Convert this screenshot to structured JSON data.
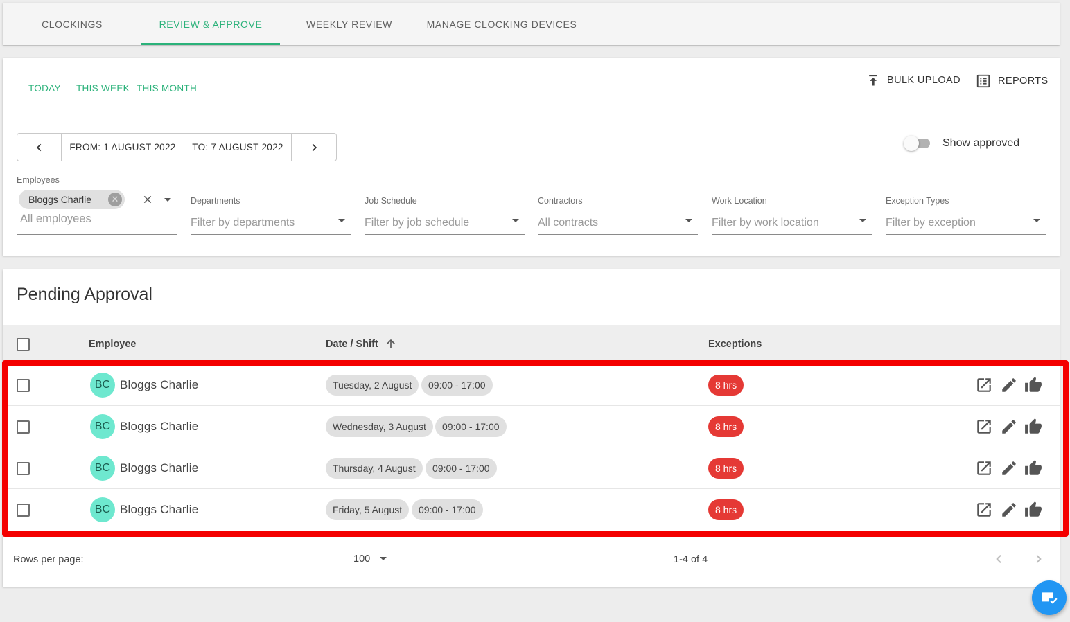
{
  "tabs": [
    {
      "label": "CLOCKINGS",
      "active": false
    },
    {
      "label": "REVIEW & APPROVE",
      "active": true
    },
    {
      "label": "WEEKLY REVIEW",
      "active": false
    },
    {
      "label": "MANAGE CLOCKING DEVICES",
      "active": false
    }
  ],
  "quick_ranges": {
    "today": "TODAY",
    "this_week": "THIS WEEK",
    "this_month": "THIS MONTH"
  },
  "actions": {
    "bulk_upload": "BULK UPLOAD",
    "reports": "REPORTS"
  },
  "date_range": {
    "from": "FROM: 1 AUGUST 2022",
    "to": "TO: 7 AUGUST 2022"
  },
  "show_approved": {
    "label": "Show approved",
    "checked": false
  },
  "filters": {
    "employees": {
      "label": "Employees",
      "chip": "Bloggs Charlie",
      "placeholder": "All employees"
    },
    "departments": {
      "label": "Departments",
      "placeholder": "Filter by departments"
    },
    "job_schedule": {
      "label": "Job Schedule",
      "placeholder": "Filter by job schedule"
    },
    "contractors": {
      "label": "Contractors",
      "placeholder": "All contracts"
    },
    "work_location": {
      "label": "Work Location",
      "placeholder": "Filter by work location"
    },
    "exception_types": {
      "label": "Exception Types",
      "placeholder": "Filter by exception"
    }
  },
  "pending": {
    "title": "Pending Approval",
    "columns": {
      "employee": "Employee",
      "date_shift": "Date / Shift",
      "exceptions": "Exceptions"
    },
    "rows": [
      {
        "initials": "BC",
        "name": "Bloggs Charlie",
        "date": "Tuesday, 2 August",
        "shift": "09:00 - 17:00",
        "exception": "8 hrs"
      },
      {
        "initials": "BC",
        "name": "Bloggs Charlie",
        "date": "Wednesday, 3 August",
        "shift": "09:00 - 17:00",
        "exception": "8 hrs"
      },
      {
        "initials": "BC",
        "name": "Bloggs Charlie",
        "date": "Thursday, 4 August",
        "shift": "09:00 - 17:00",
        "exception": "8 hrs"
      },
      {
        "initials": "BC",
        "name": "Bloggs Charlie",
        "date": "Friday, 5 August",
        "shift": "09:00 - 17:00",
        "exception": "8 hrs"
      }
    ]
  },
  "pagination": {
    "rows_per_page_label": "Rows per page:",
    "rows_per_page": "100",
    "range": "1-4 of 4"
  },
  "colors": {
    "accent": "#2bb27a",
    "exception_badge": "#e53935",
    "avatar": "#6ee8cf",
    "highlight": "#f40000",
    "fab": "#2196f3"
  }
}
